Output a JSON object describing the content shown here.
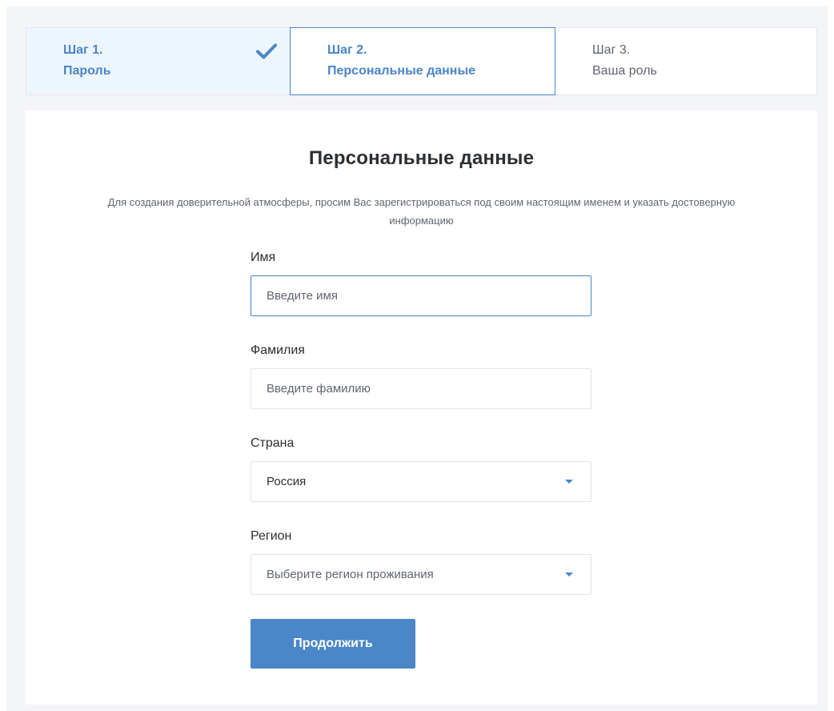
{
  "stepper": {
    "steps": [
      {
        "number": "Шаг 1.",
        "title": "Пароль",
        "state": "completed"
      },
      {
        "number": "Шаг 2.",
        "title": "Персональные данные",
        "state": "active"
      },
      {
        "number": "Шаг 3.",
        "title": "Ваша роль",
        "state": "pending"
      }
    ],
    "completed_icon": "check-icon"
  },
  "card": {
    "title": "Персональные данные",
    "description": "Для создания доверительной атмосферы, просим Вас зарегистрироваться под своим настоящим именем и указать достоверную информацию"
  },
  "form": {
    "first_name": {
      "label": "Имя",
      "placeholder": "Введите имя",
      "value": ""
    },
    "last_name": {
      "label": "Фамилия",
      "placeholder": "Введите фамилию",
      "value": ""
    },
    "country": {
      "label": "Страна",
      "selected": "Россия"
    },
    "region": {
      "label": "Регион",
      "placeholder": "Выберите регион проживания"
    },
    "submit_label": "Продолжить"
  },
  "colors": {
    "accent": "#4a86c8",
    "active_step_bg": "#eef6fd",
    "page_bg": "#f4f5f8"
  }
}
